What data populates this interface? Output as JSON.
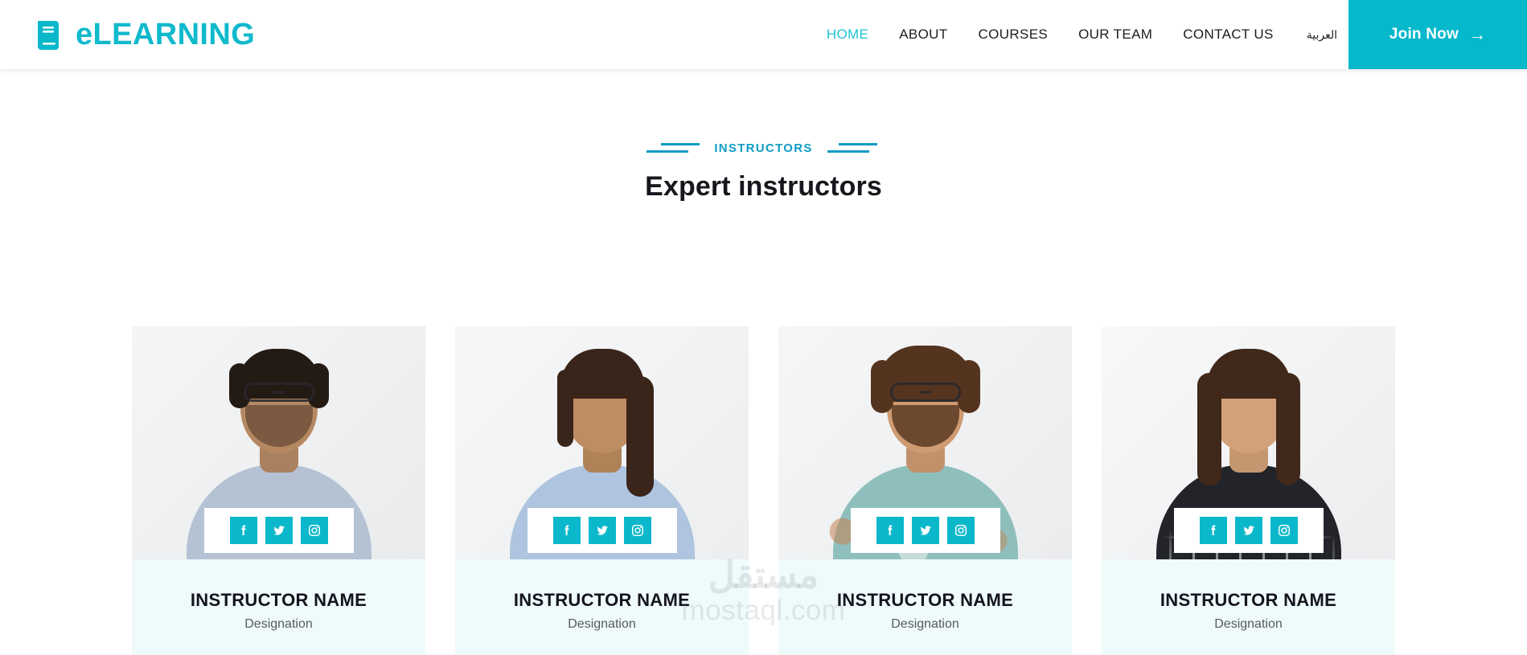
{
  "theme": {
    "accent": "#0bb8cb",
    "accent_dark": "#0e9cc4",
    "card_bg": "#effafb",
    "text_dark": "#14141f",
    "text_muted": "#565a63"
  },
  "header": {
    "brand": {
      "icon": "book-icon",
      "text": "eLEARNING"
    },
    "nav": [
      {
        "label": "HOME",
        "active": true
      },
      {
        "label": "ABOUT",
        "active": false
      },
      {
        "label": "COURSES",
        "active": false
      },
      {
        "label": "OUR TEAM",
        "active": false
      },
      {
        "label": "CONTACT US",
        "active": false
      }
    ],
    "language_link": "العربية",
    "cta": {
      "label": "Join Now",
      "arrow": "→"
    }
  },
  "section": {
    "eyebrow": "INSTRUCTORS",
    "title": "Expert instructors"
  },
  "social": [
    {
      "name": "facebook-icon",
      "label": "Facebook"
    },
    {
      "name": "twitter-icon",
      "label": "Twitter"
    },
    {
      "name": "instagram-icon",
      "label": "Instagram"
    }
  ],
  "instructors": [
    {
      "name": "INSTRUCTOR NAME",
      "role": "Designation"
    },
    {
      "name": "INSTRUCTOR NAME",
      "role": "Designation"
    },
    {
      "name": "INSTRUCTOR NAME",
      "role": "Designation"
    },
    {
      "name": "INSTRUCTOR NAME",
      "role": "Designation"
    }
  ],
  "watermark": {
    "arabic": "مستقل",
    "latin": "mostaql.com"
  }
}
